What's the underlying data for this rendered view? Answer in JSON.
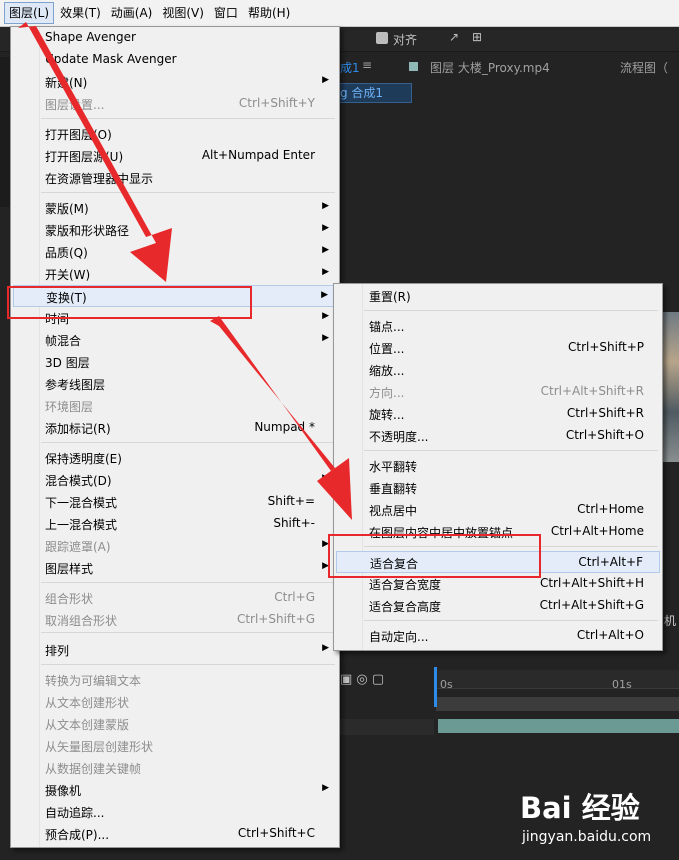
{
  "menubar": {
    "items": [
      "图层(L)",
      "效果(T)",
      "动画(A)",
      "视图(V)",
      "窗口",
      "帮助(H)"
    ],
    "active_index": 0
  },
  "toolbar": {
    "snap_label": "对齐"
  },
  "background": {
    "comp_tab": "成1",
    "layer_tab": "图层 大楼_Proxy.mp4",
    "flowchart_tab": "流程图（",
    "comp_sub": "g 合成1",
    "timecode_left": "0s",
    "timecode_right": "01s",
    "cam_label": "机"
  },
  "layer_menu": {
    "items": [
      {
        "label": "Shape Avenger",
        "shortcut": "",
        "submenu": false,
        "disabled": false
      },
      {
        "label": "Update Mask Avenger",
        "shortcut": "",
        "submenu": false,
        "disabled": false
      },
      {
        "label": "新建(N)",
        "shortcut": "",
        "submenu": true,
        "disabled": false
      },
      {
        "label": "图层设置...",
        "shortcut": "Ctrl+Shift+Y",
        "submenu": false,
        "disabled": true
      },
      {
        "label": "打开图层(O)",
        "shortcut": "",
        "submenu": false,
        "disabled": false
      },
      {
        "label": "打开图层源(U)",
        "shortcut": "Alt+Numpad Enter",
        "submenu": false,
        "disabled": false
      },
      {
        "label": "在资源管理器中显示",
        "shortcut": "",
        "submenu": false,
        "disabled": false
      },
      {
        "label": "蒙版(M)",
        "shortcut": "",
        "submenu": true,
        "disabled": false
      },
      {
        "label": "蒙版和形状路径",
        "shortcut": "",
        "submenu": true,
        "disabled": false
      },
      {
        "label": "品质(Q)",
        "shortcut": "",
        "submenu": true,
        "disabled": false
      },
      {
        "label": "开关(W)",
        "shortcut": "",
        "submenu": true,
        "disabled": false
      },
      {
        "label": "变换(T)",
        "shortcut": "",
        "submenu": true,
        "disabled": false
      },
      {
        "label": "时间",
        "shortcut": "",
        "submenu": true,
        "disabled": false
      },
      {
        "label": "帧混合",
        "shortcut": "",
        "submenu": true,
        "disabled": false
      },
      {
        "label": "3D 图层",
        "shortcut": "",
        "submenu": false,
        "disabled": false
      },
      {
        "label": "参考线图层",
        "shortcut": "",
        "submenu": false,
        "disabled": false
      },
      {
        "label": "环境图层",
        "shortcut": "",
        "submenu": false,
        "disabled": true
      },
      {
        "label": "添加标记(R)",
        "shortcut": "Numpad *",
        "submenu": false,
        "disabled": false
      },
      {
        "label": "保持透明度(E)",
        "shortcut": "",
        "submenu": false,
        "disabled": false
      },
      {
        "label": "混合模式(D)",
        "shortcut": "",
        "submenu": true,
        "disabled": false
      },
      {
        "label": "下一混合模式",
        "shortcut": "Shift+=",
        "submenu": false,
        "disabled": false
      },
      {
        "label": "上一混合模式",
        "shortcut": "Shift+-",
        "submenu": false,
        "disabled": false
      },
      {
        "label": "跟踪遮罩(A)",
        "shortcut": "",
        "submenu": true,
        "disabled": true
      },
      {
        "label": "图层样式",
        "shortcut": "",
        "submenu": true,
        "disabled": false
      },
      {
        "label": "组合形状",
        "shortcut": "Ctrl+G",
        "submenu": false,
        "disabled": true
      },
      {
        "label": "取消组合形状",
        "shortcut": "Ctrl+Shift+G",
        "submenu": false,
        "disabled": true
      },
      {
        "label": "排列",
        "shortcut": "",
        "submenu": true,
        "disabled": false
      },
      {
        "label": "转换为可编辑文本",
        "shortcut": "",
        "submenu": false,
        "disabled": true
      },
      {
        "label": "从文本创建形状",
        "shortcut": "",
        "submenu": false,
        "disabled": true
      },
      {
        "label": "从文本创建蒙版",
        "shortcut": "",
        "submenu": false,
        "disabled": true
      },
      {
        "label": "从矢量图层创建形状",
        "shortcut": "",
        "submenu": false,
        "disabled": true
      },
      {
        "label": "从数据创建关键帧",
        "shortcut": "",
        "submenu": false,
        "disabled": true
      },
      {
        "label": "摄像机",
        "shortcut": "",
        "submenu": true,
        "disabled": false
      },
      {
        "label": "自动追踪...",
        "shortcut": "",
        "submenu": false,
        "disabled": false
      },
      {
        "label": "预合成(P)...",
        "shortcut": "Ctrl+Shift+C",
        "submenu": false,
        "disabled": false
      }
    ]
  },
  "transform_menu": {
    "items": [
      {
        "label": "重置(R)",
        "shortcut": "",
        "disabled": false
      },
      {
        "label": "锚点...",
        "shortcut": "",
        "disabled": false
      },
      {
        "label": "位置...",
        "shortcut": "Ctrl+Shift+P",
        "disabled": false
      },
      {
        "label": "缩放...",
        "shortcut": "",
        "disabled": false
      },
      {
        "label": "方向...",
        "shortcut": "Ctrl+Alt+Shift+R",
        "disabled": true
      },
      {
        "label": "旋转...",
        "shortcut": "Ctrl+Shift+R",
        "disabled": false
      },
      {
        "label": "不透明度...",
        "shortcut": "Ctrl+Shift+O",
        "disabled": false
      },
      {
        "label": "水平翻转",
        "shortcut": "",
        "disabled": false
      },
      {
        "label": "垂直翻转",
        "shortcut": "",
        "disabled": false
      },
      {
        "label": "视点居中",
        "shortcut": "Ctrl+Home",
        "disabled": false
      },
      {
        "label": "在图层内容中居中放置锚点",
        "shortcut": "Ctrl+Alt+Home",
        "disabled": false
      },
      {
        "label": "适合复合",
        "shortcut": "Ctrl+Alt+F",
        "disabled": false
      },
      {
        "label": "适合复合宽度",
        "shortcut": "Ctrl+Alt+Shift+H",
        "disabled": false
      },
      {
        "label": "适合复合高度",
        "shortcut": "Ctrl+Alt+Shift+G",
        "disabled": false
      },
      {
        "label": "自动定向...",
        "shortcut": "Ctrl+Alt+O",
        "disabled": false
      }
    ]
  },
  "colors": {
    "annotation_red": "#e8292b",
    "menu_bg": "#f0f0f0",
    "highlight": "#e3ecf8"
  },
  "watermark": {
    "logo": "Bai 经验",
    "url": "jingyan.baidu.com"
  }
}
